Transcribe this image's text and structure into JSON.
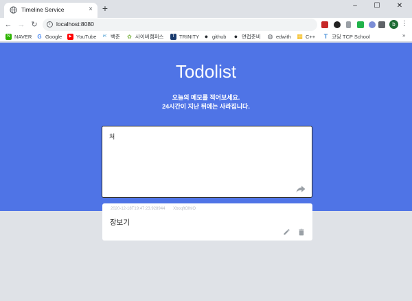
{
  "browser": {
    "tab_title": "Timeline Service",
    "tab_close": "×",
    "new_tab": "+",
    "window": {
      "minimize": "–",
      "maximize": "☐",
      "close": "✕"
    },
    "nav": {
      "back": "←",
      "forward": "→",
      "reload": "↻"
    },
    "url": "localhost:8080",
    "profile_initial": "b",
    "bookmarks": [
      {
        "label": "NAVER",
        "icon": "naver-icon",
        "color": "#2db400",
        "glyph": "N"
      },
      {
        "label": "Google",
        "icon": "google-icon",
        "color": "#4285f4",
        "glyph": "G"
      },
      {
        "label": "YouTube",
        "icon": "youtube-icon",
        "color": "#ff0000",
        "glyph": "▶"
      },
      {
        "label": "백준",
        "icon": "baekjoon-icon",
        "color": "#0076c0",
        "glyph": "/<"
      },
      {
        "label": "사이버캠퍼스",
        "icon": "cybercampus-icon",
        "color": "#7cb342",
        "glyph": "✿"
      },
      {
        "label": "TRINITY",
        "icon": "trinity-icon",
        "color": "#1a3b6e",
        "glyph": "T"
      },
      {
        "label": "github",
        "icon": "github-icon",
        "color": "#24292e",
        "glyph": "●"
      },
      {
        "label": "면접준비",
        "icon": "github-icon",
        "color": "#24292e",
        "glyph": "●"
      },
      {
        "label": "edwith",
        "icon": "globe-icon",
        "color": "#5f6368",
        "glyph": "◍"
      },
      {
        "label": "C++",
        "icon": "cpp-icon",
        "color": "#f4b400",
        "glyph": "▦"
      },
      {
        "label": "코딩 TCP School",
        "icon": "tcpschool-icon",
        "color": "#4a90d9",
        "glyph": "T"
      }
    ],
    "bookmarks_more": "»"
  },
  "page": {
    "title": "Todolist",
    "subtitle_line1": "오늘의 메모를 적어보세요.",
    "subtitle_line2": "24시간이 지난 뒤에는 사라집니다.",
    "memo_input_value": "처",
    "colors": {
      "hero": "#4f74e6",
      "background": "#dfe2e7"
    }
  },
  "memos": [
    {
      "timestamp": "2020-12-18T19:47:23.928944",
      "author": "XboqftOlhIO",
      "content": "장보기"
    }
  ]
}
